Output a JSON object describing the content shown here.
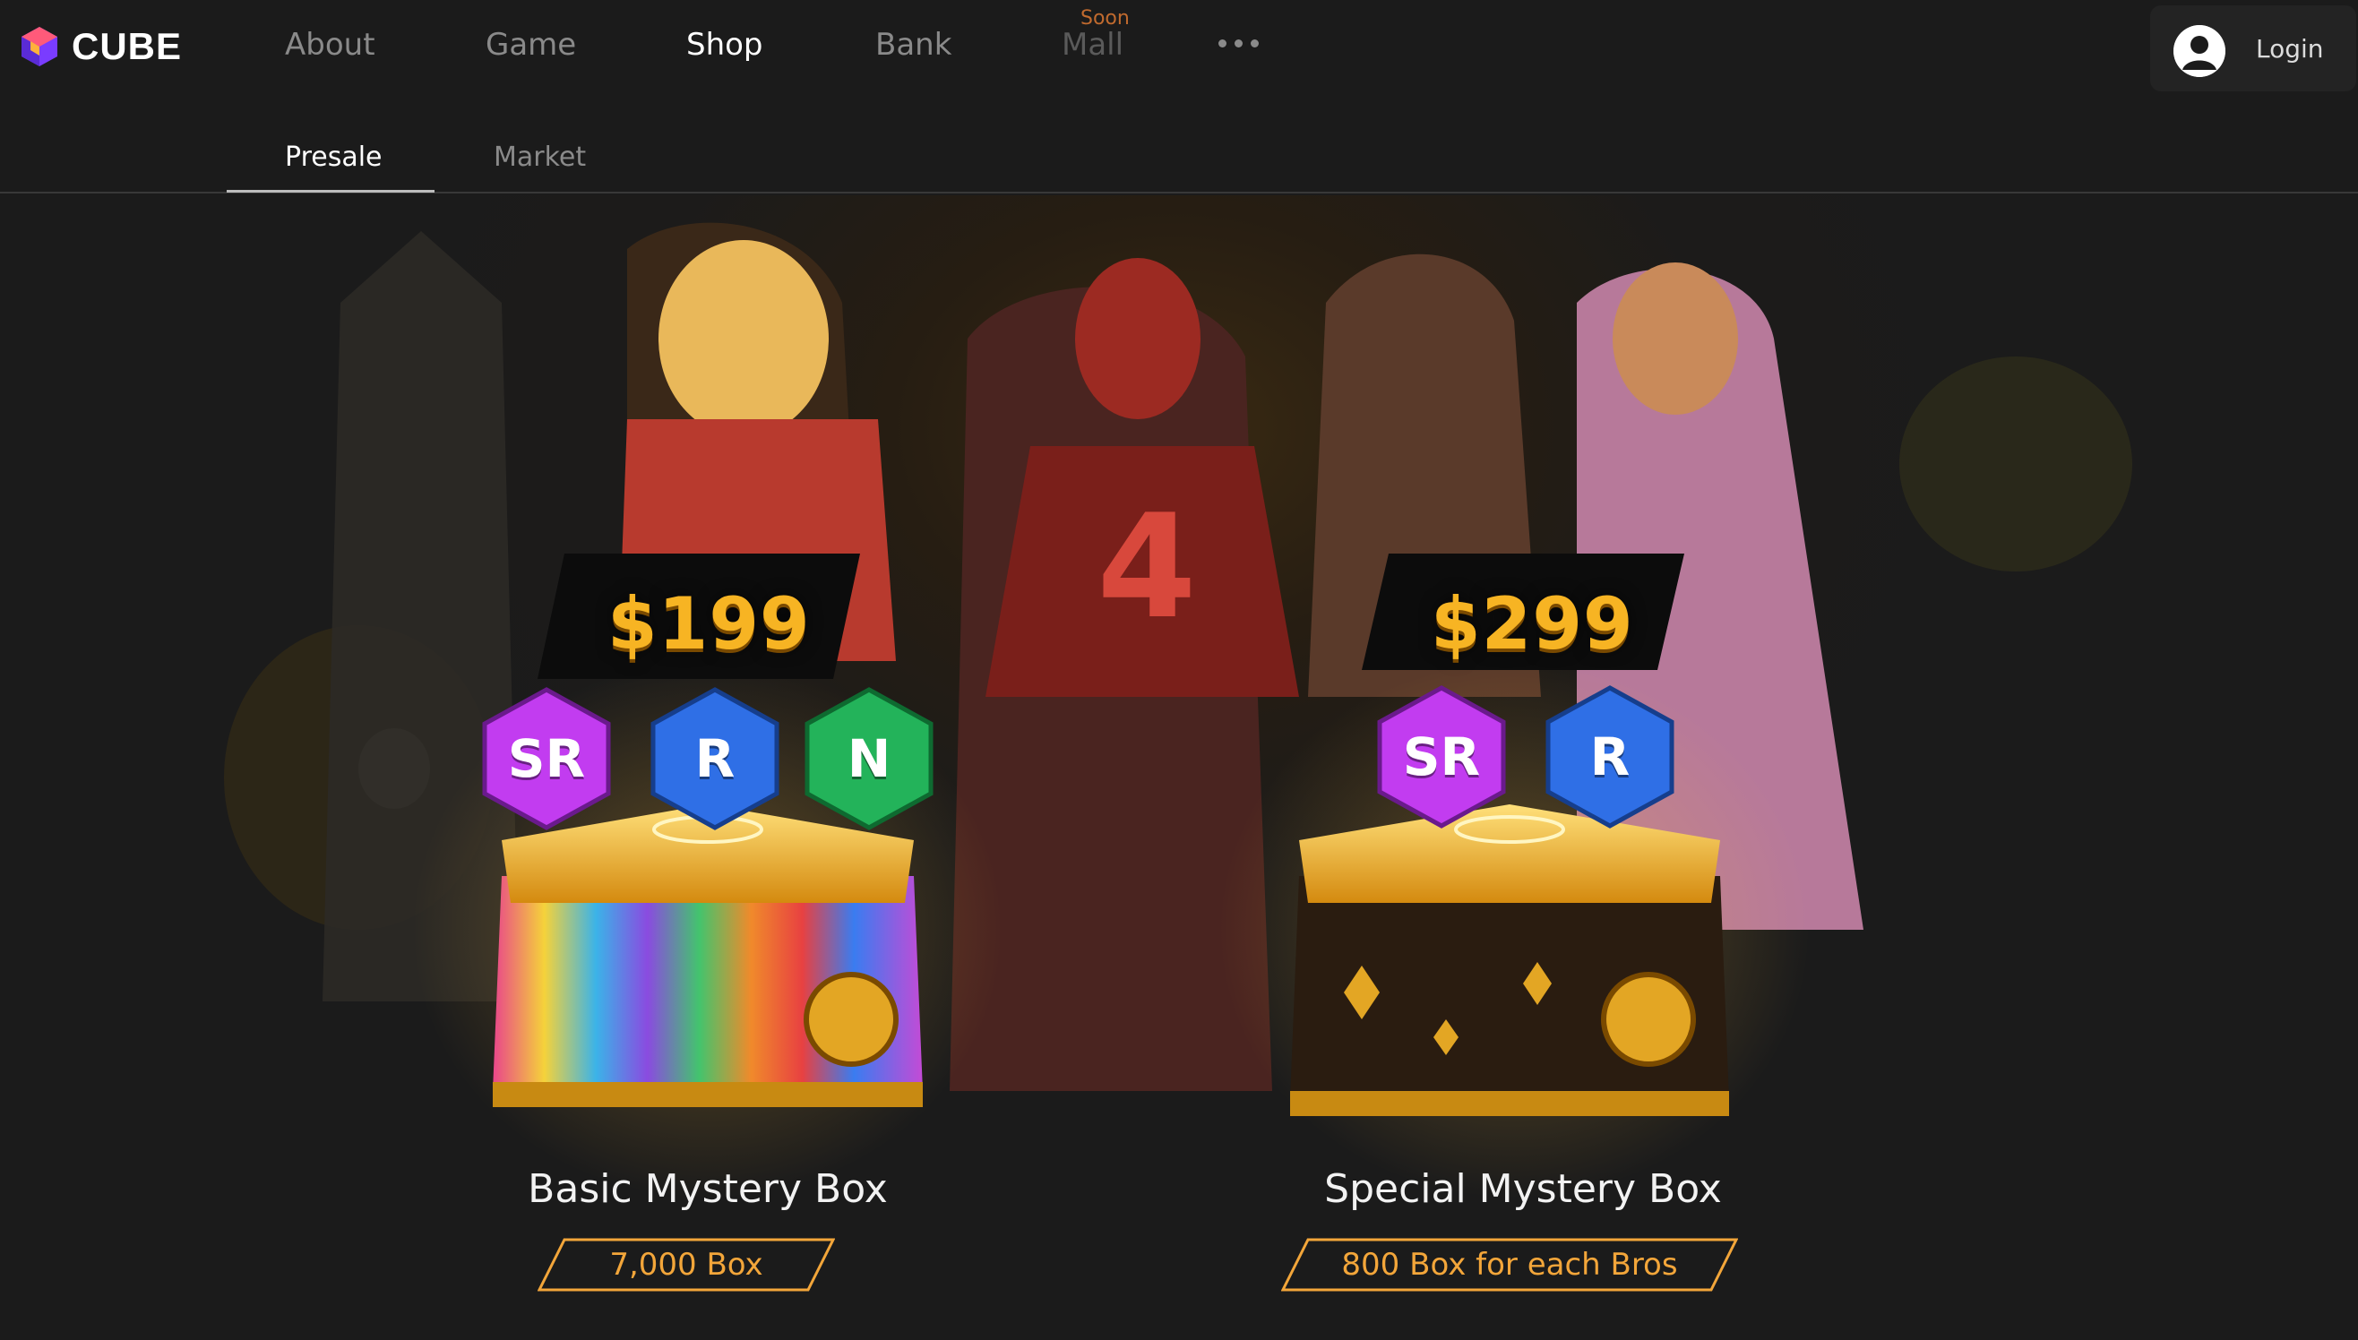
{
  "brand": {
    "name": "CUBE",
    "logo_colors": [
      "#7a3cff",
      "#ff5a7a",
      "#ff9a3c"
    ]
  },
  "nav": {
    "items": [
      {
        "label": "About",
        "state": "normal"
      },
      {
        "label": "Game",
        "state": "normal"
      },
      {
        "label": "Shop",
        "state": "active"
      },
      {
        "label": "Bank",
        "state": "normal"
      },
      {
        "label": "Mall",
        "state": "disabled",
        "badge": "Soon"
      }
    ],
    "more_icon": "ellipsis-icon"
  },
  "login": {
    "label": "Login",
    "icon": "user-avatar-icon"
  },
  "subtabs": [
    {
      "label": "Presale",
      "active": true
    },
    {
      "label": "Market",
      "active": false
    }
  ],
  "boxes": [
    {
      "name": "Basic Mystery Box",
      "price": "$199",
      "rarities": [
        "SR",
        "R",
        "N"
      ],
      "supply": "7,000 Box"
    },
    {
      "name": "Special  Mystery Box",
      "price": "$299",
      "rarities": [
        "SR",
        "R"
      ],
      "supply": "800 Box for each Bros"
    }
  ],
  "colors": {
    "accent_orange": "#f3a63a",
    "price_gold": "#f7b423",
    "rarity_sr": "#c23cf0",
    "rarity_r": "#2f6fe6",
    "rarity_n": "#23b35a",
    "soon_badge": "#c06a2e"
  }
}
